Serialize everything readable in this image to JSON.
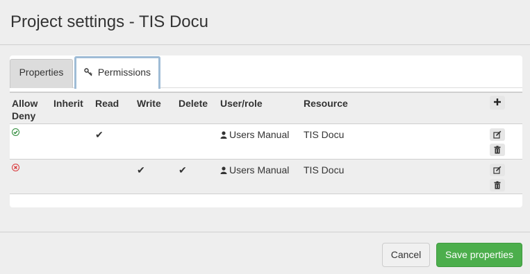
{
  "modal": {
    "title": "Project settings - TIS Docu"
  },
  "tabs": [
    {
      "label": "Properties",
      "active": false
    },
    {
      "label": "Permissions",
      "active": true,
      "icon": "key-icon"
    }
  ],
  "table": {
    "headers": {
      "allow": "Allow",
      "deny": "Deny",
      "inherit": "Inherit",
      "read": "Read",
      "write": "Write",
      "delete": "Delete",
      "user_role": "User/role",
      "resource": "Resource"
    },
    "rows": [
      {
        "status": "allow",
        "inherit": "",
        "read": "✔",
        "write": "",
        "delete": "",
        "user_role": "Users Manual",
        "resource": "TIS Docu"
      },
      {
        "status": "deny",
        "inherit": "",
        "read": "",
        "write": "✔",
        "delete": "✔",
        "user_role": "Users Manual",
        "resource": "TIS Docu"
      }
    ]
  },
  "footer": {
    "cancel_label": "Cancel",
    "save_label": "Save properties"
  },
  "colors": {
    "allow": "#2e8b3a",
    "deny": "#d9383a",
    "save_button": "#4cae4c",
    "active_tab_border": "#9fbcd6"
  }
}
